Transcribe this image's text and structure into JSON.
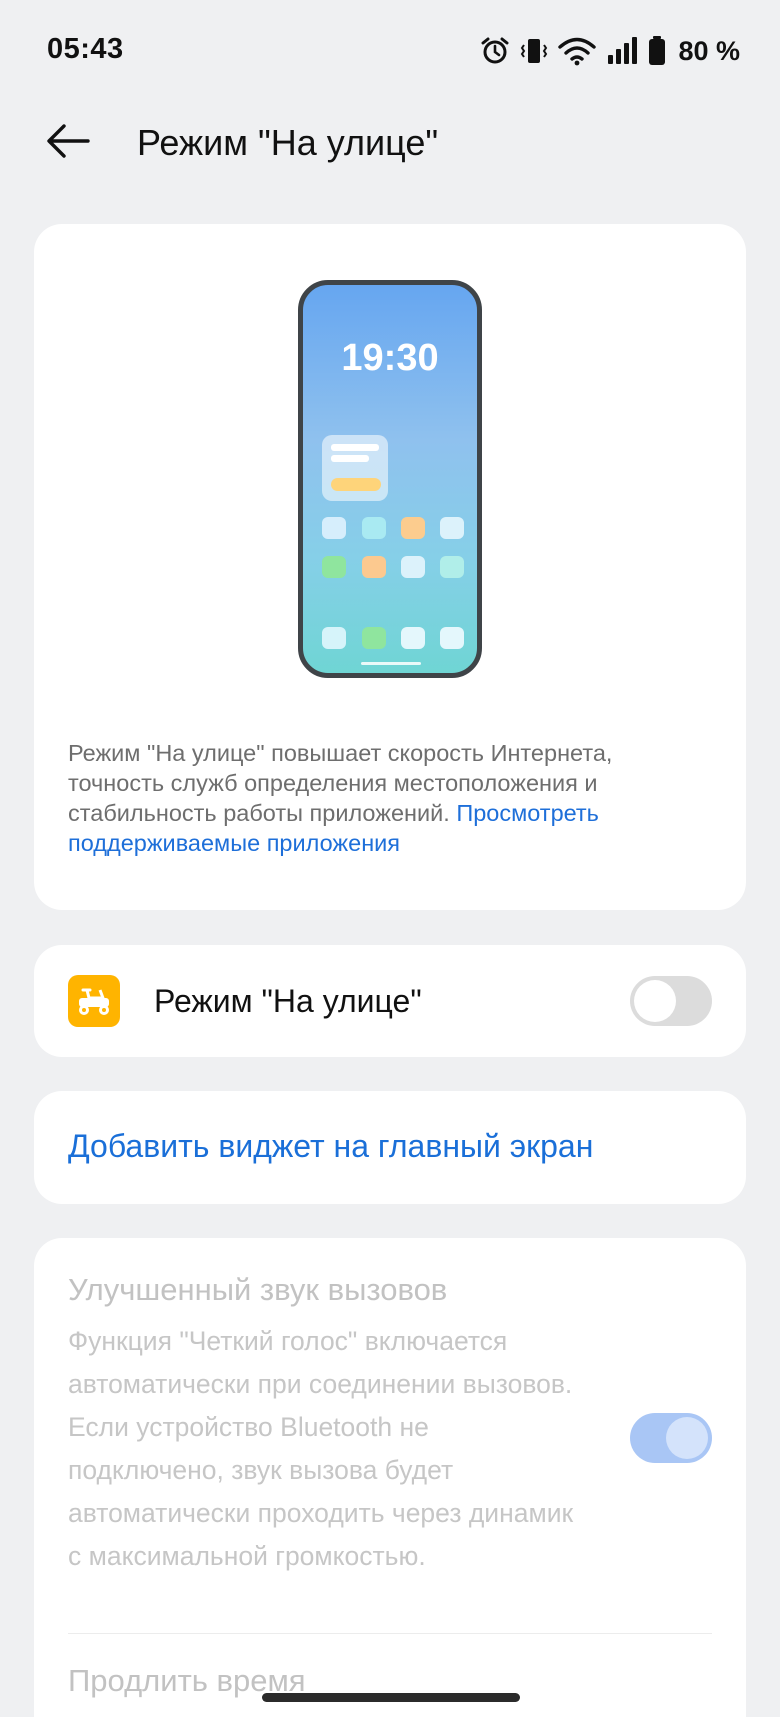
{
  "status_bar": {
    "time": "05:43",
    "battery": "80 %",
    "icons": [
      "alarm-icon",
      "vibrate-icon",
      "wifi-icon",
      "signal-icon",
      "battery-icon"
    ]
  },
  "header": {
    "back_icon": "back-arrow-icon",
    "title": "Режим \"На улице\""
  },
  "hero": {
    "phone_clock": "19:30",
    "description": "Режим \"На улице\" повышает скорость Интернета, точность служб определения местоположения и стабильность работы приложений. ",
    "link": "Просмотреть поддерживаемые приложения"
  },
  "mode_toggle": {
    "icon": "scooter-icon",
    "label": "Режим \"На улице\"",
    "enabled": false
  },
  "widget": {
    "label": "Добавить виджет на главный экран"
  },
  "calls": {
    "title": "Улучшенный звук вызовов",
    "description": "Функция \"Четкий голос\" включается автоматически при соединении вызовов. Если устройство Bluetooth не подключено, звук вызова будет автоматически проходить через динамик с максимальной громкостью.",
    "enabled": true,
    "disabled_state": true
  },
  "extend": {
    "label": "Продлить время"
  },
  "colors": {
    "background": "#eff0f2",
    "accent": "#1a6fd8",
    "mode_icon": "#ffb400"
  }
}
